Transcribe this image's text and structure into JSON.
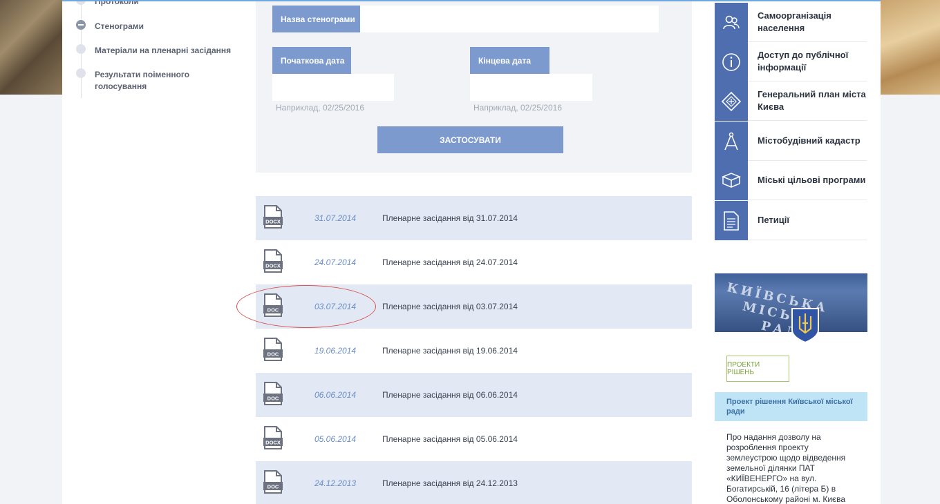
{
  "left_nav": {
    "items": [
      {
        "label": "Протоколи",
        "active": false
      },
      {
        "label": "Стенограми",
        "active": true
      },
      {
        "label": "Матеріали на пленарні засідання",
        "active": false
      },
      {
        "label": "Результати поіменного голосування",
        "active": false
      }
    ]
  },
  "filter": {
    "name_label": "Назва стенограми",
    "start_label": "Початкова дата",
    "end_label": "Кінцева дата",
    "start_hint": "Наприклад, 02/25/2016",
    "end_hint": "Наприклад, 02/25/2016",
    "apply_label": "ЗАСТОСУВАТИ"
  },
  "documents": [
    {
      "type": "DOCX",
      "date": "31.07.2014",
      "title": "Пленарне засідання від 31.07.2014"
    },
    {
      "type": "DOCX",
      "date": "24.07.2014",
      "title": "Пленарне засідання від 24.07.2014"
    },
    {
      "type": "DOC",
      "date": "03.07.2014",
      "title": "Пленарне засідання від 03.07.2014",
      "highlighted": true
    },
    {
      "type": "DOC",
      "date": "19.06.2014",
      "title": "Пленарне засідання від 19.06.2014"
    },
    {
      "type": "DOC",
      "date": "06.06.2014",
      "title": "Пленарне засідання від 06.06.2014"
    },
    {
      "type": "DOCX",
      "date": "05.06.2014",
      "title": "Пленарне засідання від 05.06.2014"
    },
    {
      "type": "DOC",
      "date": "24.12.2013",
      "title": "Пленарне засідання від 24.12.2013"
    }
  ],
  "services": [
    {
      "label": "Самоорганізація населення",
      "icon": "people-icon"
    },
    {
      "label": "Доступ до публічної інформації",
      "icon": "info-icon"
    },
    {
      "label": "Генеральний план міста Києва",
      "icon": "map-plan-icon"
    },
    {
      "label": "Містобудівний кадастр",
      "icon": "compass-icon"
    },
    {
      "label": "Міські цільові програми",
      "icon": "books-icon"
    },
    {
      "label": "Петиції",
      "icon": "document-icon"
    }
  ],
  "banner": {
    "sign_line1": "КИЇВСЬКА",
    "sign_line2": "МІСЬКА",
    "sign_line3": "РАДА"
  },
  "projects": {
    "button_label": "ПРОЕКТИ РІШЕНЬ",
    "header": "Проект рішення Київської міської ради",
    "body": "Про надання дозволу на розроблення проекту землеустрою щодо відведення земельної ділянки ПАТ «КИЇВЕНЕРГО» на вул. Богатирській, 16 (літера Б) в Оболонському районі м. Києва"
  },
  "colors": {
    "accent": "#7d9acf",
    "service_icon_bg": "#4e6eb0",
    "row_alt": "#e3e9f4",
    "highlight_oval": "#d9534f"
  }
}
